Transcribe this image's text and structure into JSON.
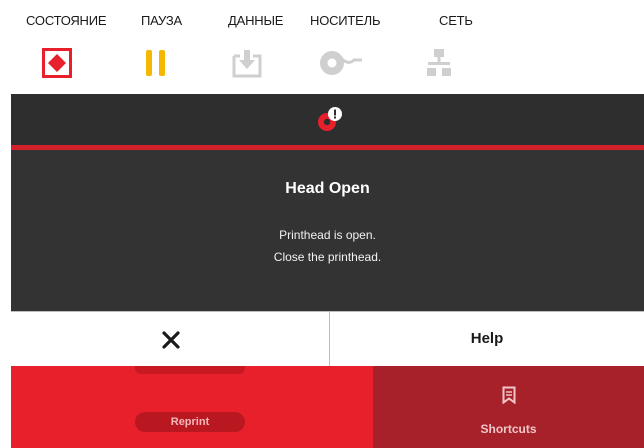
{
  "indicators": [
    {
      "label": "СОСТОЯНИЕ",
      "icon": "status-stop-icon",
      "color": "#e8202b"
    },
    {
      "label": "ПАУЗА",
      "icon": "pause-icon",
      "color": "#f5b800"
    },
    {
      "label": "ДАННЫЕ",
      "icon": "data-download-icon",
      "color": "#cfcfcf"
    },
    {
      "label": "НОСИТЕЛЬ",
      "icon": "media-roll-icon",
      "color": "#cfcfcf"
    },
    {
      "label": "СЕТЬ",
      "icon": "network-icon",
      "color": "#cfcfcf"
    }
  ],
  "screen": {
    "alert_icon": "error-alert-icon",
    "accent_color": "#d4202a",
    "dialog": {
      "title": "Head Open",
      "message_line1": "Printhead is open.",
      "message_line2": "Close the printhead."
    },
    "buttons": {
      "close_icon": "close-icon",
      "help_label": "Help"
    },
    "tiles": {
      "reprint_label": "Reprint",
      "shortcuts_icon": "bookmark-icon",
      "shortcuts_label": "Shortcuts"
    }
  }
}
